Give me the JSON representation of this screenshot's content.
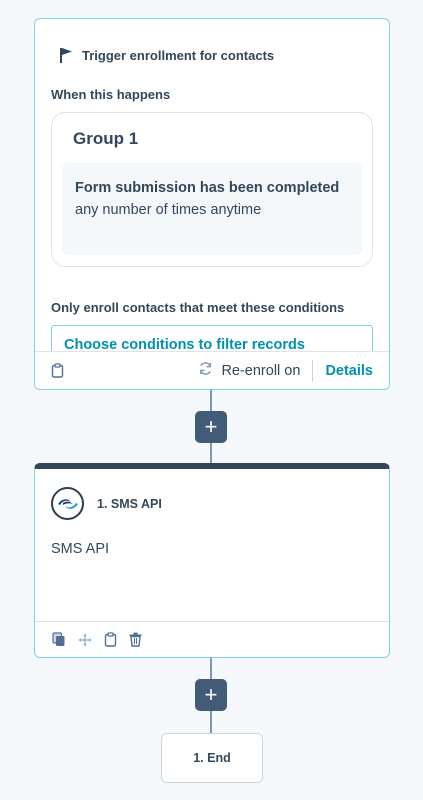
{
  "trigger": {
    "title": "Trigger enrollment for contacts",
    "when_label": "When this happens",
    "group": {
      "title": "Group 1",
      "condition_bold": "Form submission has been completed",
      "condition_rest": "any number of times anytime"
    },
    "filter_label": "Only enroll contacts that meet these conditions",
    "filter_placeholder": "Choose conditions to filter records",
    "footer": {
      "reenroll_label": "Re-enroll on",
      "details_label": "Details"
    }
  },
  "connectors": {
    "add_step_symbol": "+"
  },
  "action": {
    "title": "1. SMS API",
    "body": "SMS API",
    "footer_icons": [
      "copy-icon",
      "move-icon",
      "clipboard-icon",
      "trash-icon"
    ]
  },
  "end": {
    "label": "1. End"
  },
  "colors": {
    "accent": "#0091ae",
    "border": "#7fd1de",
    "dark": "#33475b",
    "plus_bg": "#425b76",
    "connector": "#7c98b6"
  }
}
